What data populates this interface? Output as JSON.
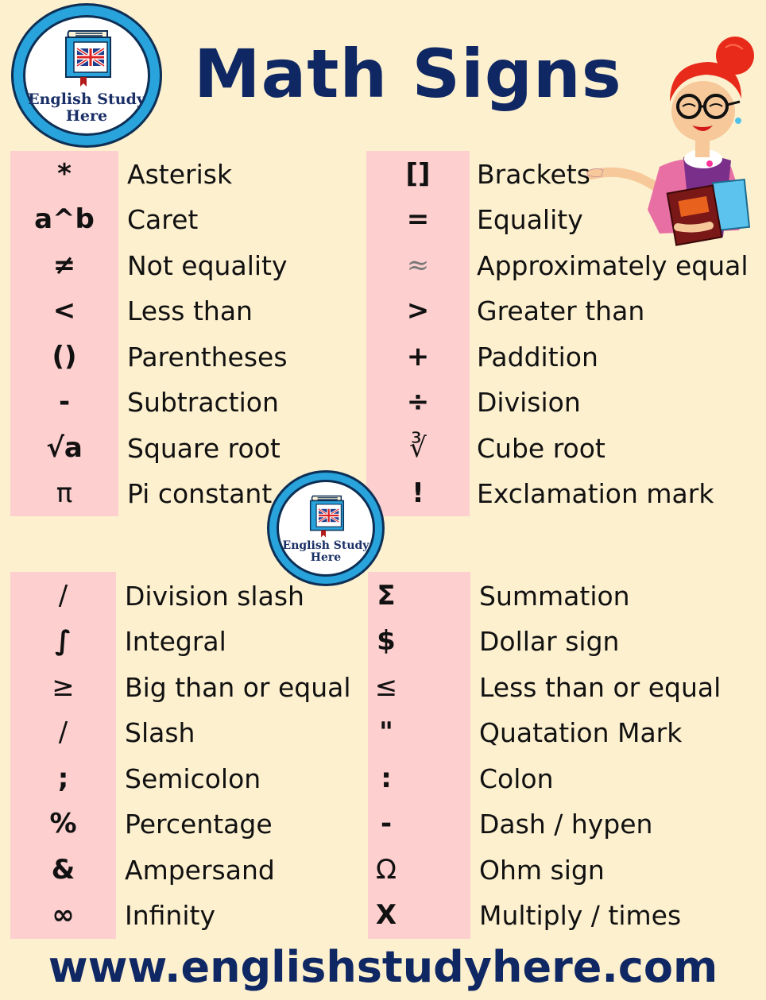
{
  "title": "Math Signs",
  "logo": {
    "line1": "English Study",
    "line2": "Here",
    "icon": "book-with-uk-flag-icon"
  },
  "character": {
    "icon": "teacher-woman-illustration"
  },
  "colors": {
    "background": "#fdf0cf",
    "symbol_column": "#fdcfcf",
    "title_navy": "#0f2763",
    "logo_blue": "#29a3dc"
  },
  "tables": [
    {
      "rows": [
        {
          "symbol": "*",
          "name": "Asterisk"
        },
        {
          "symbol": "a^b",
          "name": "Caret"
        },
        {
          "symbol": "≠",
          "name": "Not equality"
        },
        {
          "symbol": "<",
          "name": "Less than"
        },
        {
          "symbol": "()",
          "name": "Parentheses"
        },
        {
          "symbol": "-",
          "name": "Subtraction"
        },
        {
          "symbol": "√a",
          "name": "Square root"
        },
        {
          "symbol": "π",
          "name": "Pi constant"
        }
      ]
    },
    {
      "rows": [
        {
          "symbol": "[]",
          "name": "Brackets"
        },
        {
          "symbol": "=",
          "name": "Equality"
        },
        {
          "symbol": "≈",
          "name": "Approximately equal"
        },
        {
          "symbol": ">",
          "name": "Greater than"
        },
        {
          "symbol": "+",
          "name": "Paddition"
        },
        {
          "symbol": "÷",
          "name": "Division"
        },
        {
          "symbol": "∛",
          "name": "Cube root"
        },
        {
          "symbol": "!",
          "name": "Exclamation mark"
        }
      ]
    },
    {
      "rows": [
        {
          "symbol": "/",
          "name": "Division slash"
        },
        {
          "symbol": "∫",
          "name": "Integral"
        },
        {
          "symbol": "≥",
          "name": "Big than or equal"
        },
        {
          "symbol": "/",
          "name": "Slash"
        },
        {
          "symbol": ";",
          "name": "Semicolon"
        },
        {
          "symbol": "%",
          "name": "Percentage"
        },
        {
          "symbol": "&",
          "name": "Ampersand"
        },
        {
          "symbol": "∞",
          "name": "Infinity"
        }
      ]
    },
    {
      "rows": [
        {
          "symbol": "Σ",
          "name": "Summation"
        },
        {
          "symbol": "$",
          "name": "Dollar sign"
        },
        {
          "symbol": "≤",
          "name": "Less than or equal"
        },
        {
          "symbol": "\"",
          "name": "Quatation Mark"
        },
        {
          "symbol": ":",
          "name": "Colon"
        },
        {
          "symbol": "-",
          "name": "Dash / hypen"
        },
        {
          "symbol": "Ω",
          "name": "Ohm sign"
        },
        {
          "symbol": "X",
          "name": "Multiply / times"
        }
      ]
    }
  ],
  "footer": {
    "url": "www.englishstudyhere.com"
  }
}
